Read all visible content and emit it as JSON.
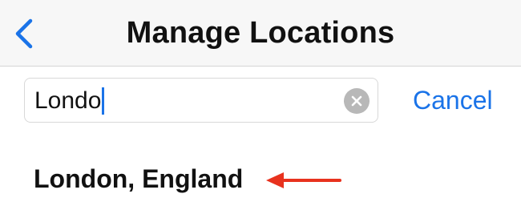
{
  "nav": {
    "title": "Manage Locations",
    "back_icon": "chevron-left-icon"
  },
  "search": {
    "value": "Londo",
    "clear_icon": "clear-circle-icon",
    "cancel_label": "Cancel"
  },
  "results": [
    {
      "label": "London, England"
    }
  ],
  "annotation": {
    "arrow_icon": "arrow-left-icon",
    "arrow_color": "#e8321e"
  },
  "colors": {
    "accent": "#1a73e8",
    "nav_background": "#f7f7f7"
  }
}
